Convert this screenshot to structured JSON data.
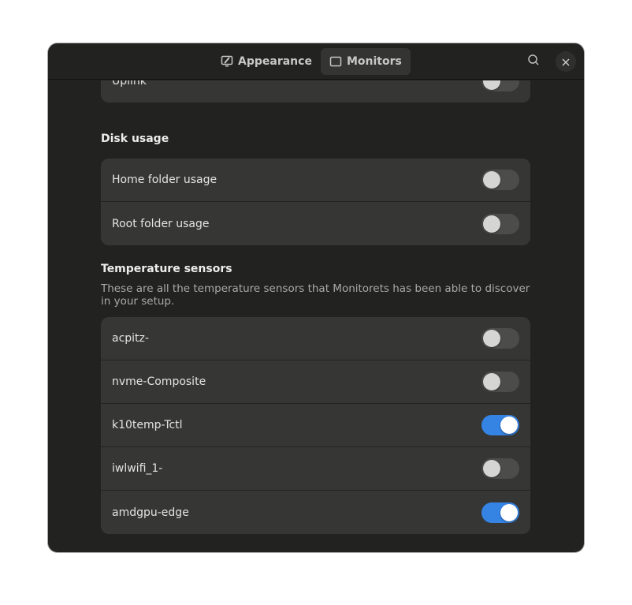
{
  "headerbar": {
    "tabs": [
      {
        "label": "Appearance",
        "icon": "appearance-icon",
        "active": false
      },
      {
        "label": "Monitors",
        "icon": "monitor-icon",
        "active": true
      }
    ],
    "search_icon": "search-icon",
    "close_icon": "close-icon"
  },
  "network": {
    "rows": [
      {
        "label": "Uplink",
        "enabled": false
      }
    ]
  },
  "disk": {
    "title": "Disk usage",
    "rows": [
      {
        "label": "Home folder usage",
        "enabled": false
      },
      {
        "label": "Root folder usage",
        "enabled": false
      }
    ]
  },
  "temperature": {
    "title": "Temperature sensors",
    "description": "These are all the temperature sensors that Monitorets has been able to discover in your setup.",
    "rows": [
      {
        "label": "acpitz-",
        "enabled": false
      },
      {
        "label": "nvme-Composite",
        "enabled": false
      },
      {
        "label": "k10temp-Tctl",
        "enabled": true
      },
      {
        "label": "iwlwifi_1-",
        "enabled": false
      },
      {
        "label": "amdgpu-edge",
        "enabled": true
      }
    ]
  },
  "colors": {
    "accent": "#3584e4",
    "window_bg": "#222220",
    "row_bg": "#363735"
  }
}
